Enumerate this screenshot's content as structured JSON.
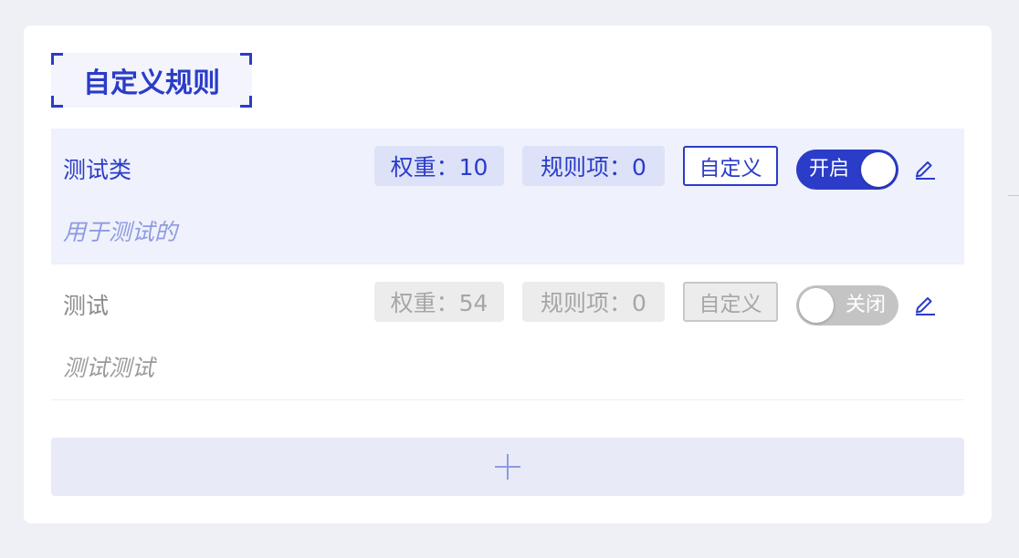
{
  "section": {
    "title": "自定义规则"
  },
  "rules": [
    {
      "name": "测试类",
      "description": "用于测试的",
      "weight_label": "权重：10",
      "items_label": "规则项：0",
      "custom_label": "自定义",
      "toggle_label": "开启",
      "enabled": true
    },
    {
      "name": "测试",
      "description": "测试测试",
      "weight_label": "权重：54",
      "items_label": "规则项：0",
      "custom_label": "自定义",
      "toggle_label": "关闭",
      "enabled": false
    }
  ],
  "icons": {
    "edit": "edit-icon",
    "add": "plus-icon"
  },
  "colors": {
    "accent": "#2b3cc8",
    "active_row_bg": "#eff1fc",
    "toggle_off": "#c4c4c4"
  }
}
